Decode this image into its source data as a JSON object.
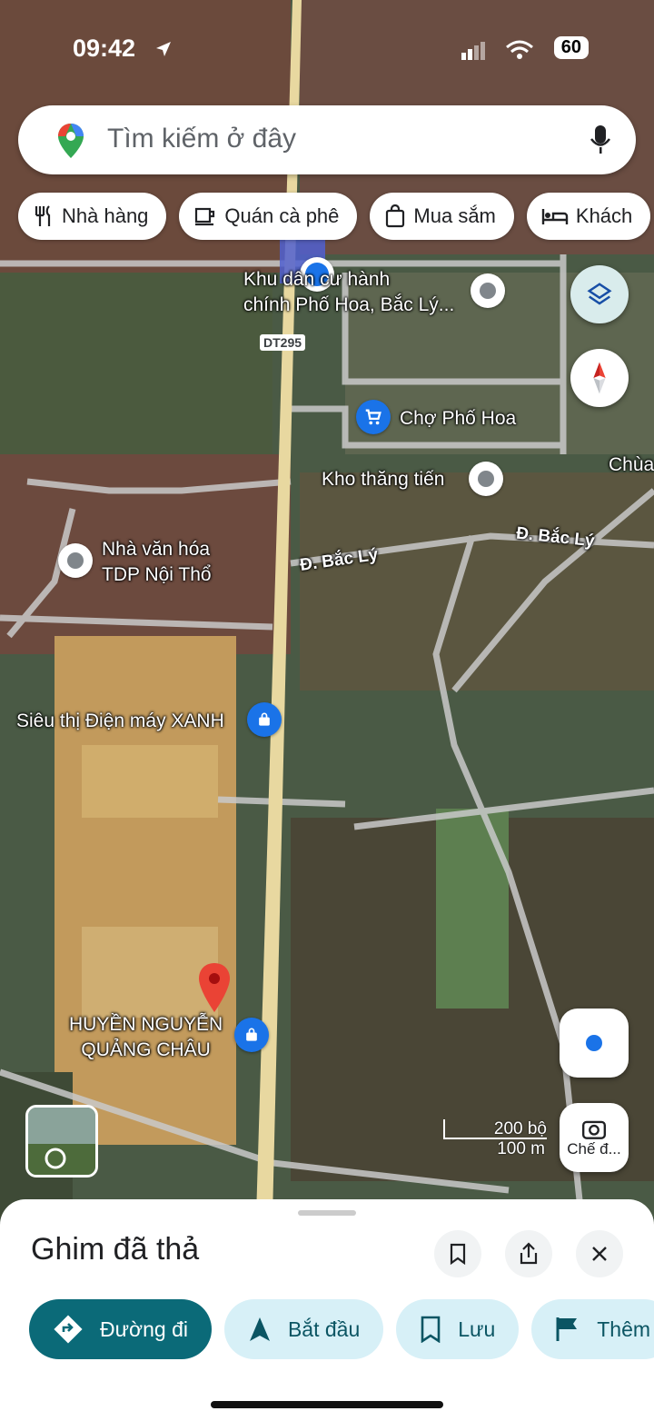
{
  "status": {
    "time": "09:42",
    "battery": "60"
  },
  "search": {
    "placeholder": "Tìm kiếm ở đây"
  },
  "chips": [
    {
      "label": "Nhà hàng",
      "icon": "fork-knife-icon"
    },
    {
      "label": "Quán cà phê",
      "icon": "coffee-cup-icon"
    },
    {
      "label": "Mua sắm",
      "icon": "shopping-bag-icon"
    },
    {
      "label": "Khách",
      "icon": "bed-icon"
    }
  ],
  "map": {
    "road_badge": "DT295",
    "places": {
      "khu_dan_cu": "Khu dân cư hành\nchính Phố Hoa, Bắc Lý...",
      "cho": "Chợ Phố Hoa",
      "kho": "Kho thăng tiến",
      "chua": "Chùa",
      "nha_van_hoa": "Nhà văn hóa\nTDP Nội Thổ",
      "duong_bac_ly_1": "Đ. Bắc Lý",
      "duong_bac_ly_2": "Đ. Bắc Lý",
      "sieu_thi": "Siêu thị Điện máy XANH",
      "huyen": "HUYỀN NGUYỄN\nQUẢNG CHÂU"
    },
    "scale": {
      "imperial": "200 bộ",
      "metric": "100 m"
    },
    "lens_label": "Chế đ..."
  },
  "sheet": {
    "title": "Ghim đã thả",
    "actions": [
      {
        "label": "Đường đi",
        "icon": "directions-icon"
      },
      {
        "label": "Bắt đầu",
        "icon": "navigation-arrow-icon"
      },
      {
        "label": "Lưu",
        "icon": "bookmark-icon"
      },
      {
        "label": "Thêm",
        "icon": "flag-icon"
      }
    ]
  },
  "colors": {
    "accent": "#0b6a78",
    "pin_red": "#ea4335",
    "location_blue": "#1a73e8"
  }
}
